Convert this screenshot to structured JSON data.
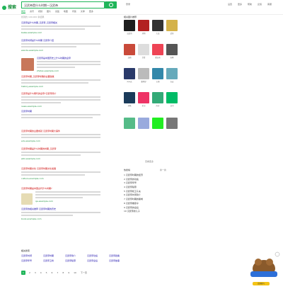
{
  "header": {
    "logo": "搜索",
    "search_value": "汉武帝是什么时期—汉武帝",
    "links": [
      "登录",
      "设置",
      "更多",
      "帮助",
      "反馈",
      "客服"
    ]
  },
  "tabs": [
    "网页",
    "资讯",
    "视频",
    "图片",
    "良医",
    "地图",
    "问答",
    "文库",
    "更多"
  ],
  "meta": "找到约 100,000 条结果",
  "results": [
    {
      "title": "汉武帝是什么时期_汉武帝_汉武帝相关",
      "url": "baike.example.com"
    },
    {
      "title": "汉武帝刘彻是什么时期 汉武帝介绍",
      "url": "wenda.example.com"
    },
    {
      "title": "汉武帝是中国历史上什么时期的皇帝",
      "url": "zhidao.example.com"
    },
    {
      "title": "汉武帝时期_汉武帝时期的主要政策",
      "url": "history.example.com"
    },
    {
      "title": "汉武帝是什么朝代的皇帝?汉武帝简介",
      "url": "news.example.com"
    },
    {
      "title": "汉武帝时期",
      "url": ""
    },
    {
      "title": "汉武帝时期的主要成就 汉武帝时期大事件",
      "url": "edu.example.com"
    },
    {
      "title": "汉武帝时期是什么时期的时期_汉武帝",
      "url": "wiki.example.com"
    },
    {
      "title": "汉武帝时期文化 汉武帝时期文化发展",
      "url": "culture.example.com"
    },
    {
      "title": "汉武帝时期是中国古代什么时期?",
      "url": "qa.example.com"
    },
    {
      "title": "汉武帝的相关推荐 汉武帝时期的历史",
      "url": "book.example.com"
    }
  ],
  "side": {
    "title": "相关图片推荐",
    "captions": [
      "汉武帝",
      "刘彻",
      "大汉",
      "武帝",
      "汉朝",
      "卫青",
      "霍去病",
      "张骞",
      "司马迁",
      "董仲舒",
      "王朝",
      "长安",
      "丝路",
      "史记",
      "历史",
      "汉书"
    ],
    "more": "查看更多",
    "hot_title": "热搜榜",
    "hot_more": "换一换",
    "hot": [
      "1 汉武帝时期的经济",
      "2 汉武帝的功绩",
      "3 汉武帝年号",
      "4 汉武帝陵墓",
      "5 汉武帝和卫子夫",
      "6 汉武帝刘彻简介",
      "7 汉武帝时期的疆域",
      "8 汉武帝推恩令",
      "9 汉武帝的皇后",
      "10 汉武帝的儿子"
    ]
  },
  "related": {
    "title": "相关搜索",
    "items": [
      "汉武帝刘彻",
      "汉武帝时期",
      "汉武帝简介",
      "汉武帝功绩",
      "汉武帝政策",
      "汉武帝年号",
      "汉武帝卫青",
      "汉武帝陵墓",
      "汉武帝皇后",
      "汉武帝故事",
      "汉武帝传",
      "汉武帝大帝"
    ]
  },
  "pager": [
    "1",
    "2",
    "3",
    "4",
    "5",
    "6",
    "7",
    "8",
    "9",
    "10",
    "下一页"
  ],
  "promo": {
    "button": "立即参与"
  }
}
